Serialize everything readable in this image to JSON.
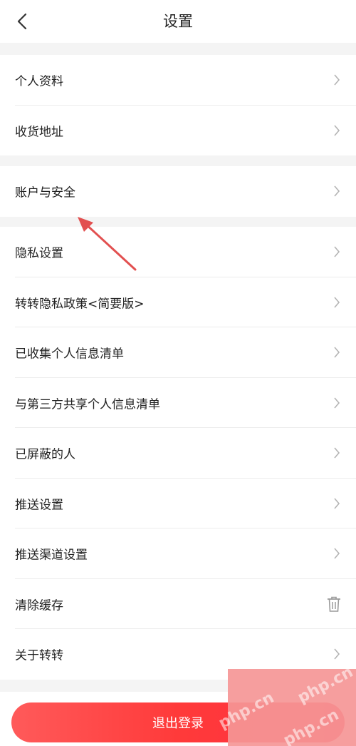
{
  "header": {
    "title": "设置"
  },
  "groups": [
    {
      "items": [
        {
          "label": "个人资料"
        },
        {
          "label": "收货地址"
        }
      ]
    },
    {
      "items": [
        {
          "label": "账户与安全"
        }
      ]
    },
    {
      "items": [
        {
          "label": "隐私设置"
        },
        {
          "label": "转转隐私政策<简要版>"
        },
        {
          "label": "已收集个人信息清单"
        },
        {
          "label": "与第三方共享个人信息清单"
        },
        {
          "label": "已屏蔽的人"
        },
        {
          "label": "推送设置"
        },
        {
          "label": "推送渠道设置"
        },
        {
          "label": "清除缓存"
        },
        {
          "label": "关于转转"
        }
      ]
    }
  ],
  "logout_label": "退出登录",
  "watermark": {
    "text_1": "php.cn",
    "text_2": "php.cn",
    "text_3": "php.cn"
  },
  "colors": {
    "accent": "#ff4646",
    "annotation": "#e25050"
  }
}
